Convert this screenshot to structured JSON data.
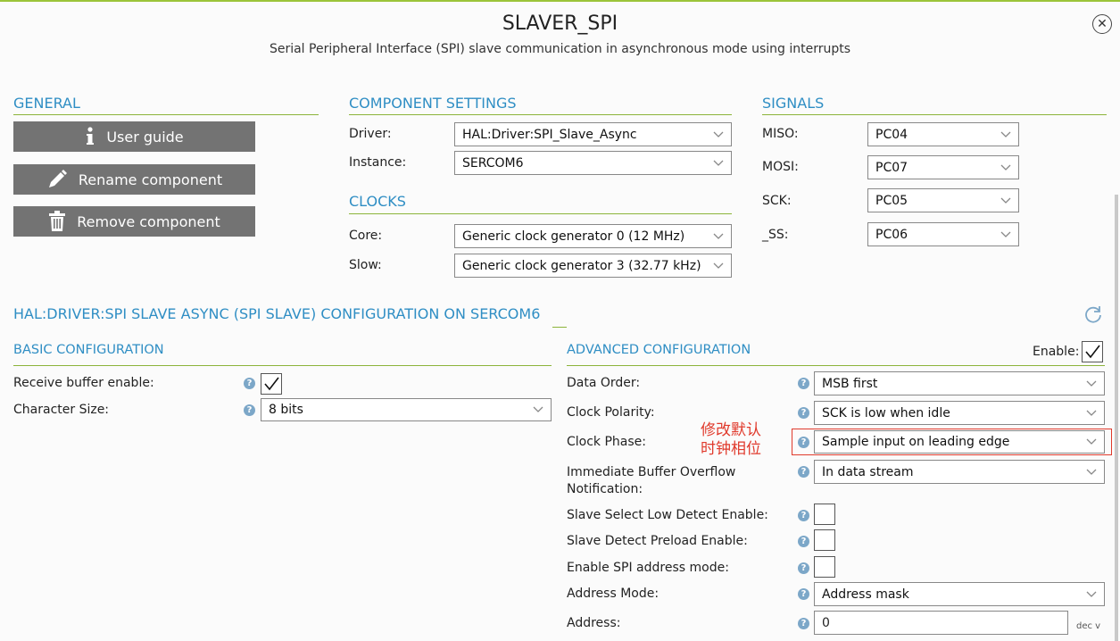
{
  "header": {
    "title": "SLAVER_SPI",
    "subtitle": "Serial Peripheral Interface (SPI) slave communication in asynchronous mode using interrupts"
  },
  "general": {
    "heading": "GENERAL",
    "user_guide": "User guide",
    "rename": "Rename component",
    "remove": "Remove component"
  },
  "component_settings": {
    "heading": "COMPONENT SETTINGS",
    "driver_label": "Driver:",
    "driver_value": "HAL:Driver:SPI_Slave_Async",
    "instance_label": "Instance:",
    "instance_value": "SERCOM6"
  },
  "clocks": {
    "heading": "CLOCKS",
    "core_label": "Core:",
    "core_value": "Generic clock generator 0 (12 MHz)",
    "slow_label": "Slow:",
    "slow_value": "Generic clock generator 3 (32.77 kHz)"
  },
  "signals": {
    "heading": "SIGNALS",
    "items": [
      {
        "label": "MISO:",
        "value": "PC04"
      },
      {
        "label": "MOSI:",
        "value": "PC07"
      },
      {
        "label": "SCK:",
        "value": "PC05"
      },
      {
        "label": "_SS:",
        "value": "PC06"
      }
    ]
  },
  "config": {
    "heading": "HAL:DRIVER:SPI SLAVE ASYNC (SPI SLAVE) CONFIGURATION ON SERCOM6",
    "basic": {
      "heading": "BASIC CONFIGURATION",
      "receive_buffer_label": "Receive buffer enable:",
      "receive_buffer_checked": true,
      "char_size_label": "Character Size:",
      "char_size_value": "8 bits"
    },
    "advanced": {
      "heading": "ADVANCED CONFIGURATION",
      "enable_label": "Enable:",
      "enable_checked": true,
      "data_order_label": "Data Order:",
      "data_order_value": "MSB first",
      "clock_polarity_label": "Clock Polarity:",
      "clock_polarity_value": "SCK is low when idle",
      "clock_phase_label": "Clock Phase:",
      "clock_phase_value": "Sample input on leading edge",
      "overflow_label_1": "Immediate Buffer Overflow",
      "overflow_label_2": "Notification:",
      "overflow_value": "In data stream",
      "ss_low_label": "Slave Select Low Detect Enable:",
      "preload_label": "Slave Detect Preload Enable:",
      "addr_mode_enable_label": "Enable SPI address mode:",
      "address_mode_label": "Address Mode:",
      "address_mode_value": "Address mask",
      "address_label": "Address:",
      "address_value": "0",
      "address_unit": "dec v"
    }
  },
  "annotation": {
    "line1": "修改默认",
    "line2": "时钟相位",
    "color": "#e03a2c"
  },
  "colors": {
    "accent": "#2f8ec4",
    "divider": "#8cb43a",
    "button_bg": "#737373"
  }
}
